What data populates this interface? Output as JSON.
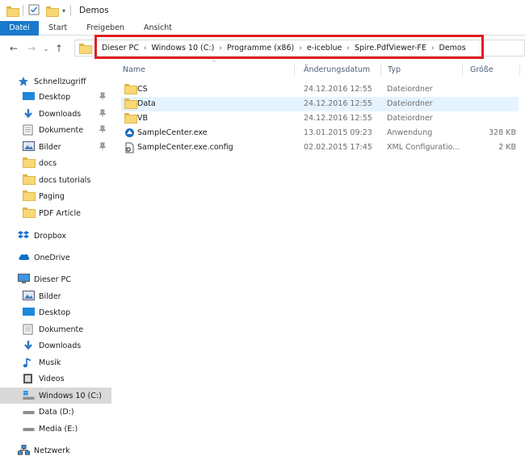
{
  "window": {
    "title": "Demos"
  },
  "ribbon": {
    "tabs": [
      "Datei",
      "Start",
      "Freigeben",
      "Ansicht"
    ]
  },
  "address": {
    "crumbs": [
      "Dieser PC",
      "Windows 10 (C:)",
      "Programme (x86)",
      "e-iceblue",
      "Spire.PdfViewer-FE",
      "Demos"
    ],
    "highlight_color": "#e21c23"
  },
  "nav": {
    "items": [
      {
        "label": "Schnellzugriff",
        "icon": "star-icon"
      },
      {
        "label": "Desktop",
        "icon": "desktop-icon"
      },
      {
        "label": "Downloads",
        "icon": "download-icon"
      },
      {
        "label": "Dokumente",
        "icon": "documents-icon"
      },
      {
        "label": "Bilder",
        "icon": "pictures-icon"
      },
      {
        "label": "docs",
        "icon": "folder-icon"
      },
      {
        "label": "docs tutorials",
        "icon": "folder-icon"
      },
      {
        "label": "Paging",
        "icon": "folder-icon"
      },
      {
        "label": "PDF Article",
        "icon": "folder-icon"
      },
      {
        "label": "Dropbox",
        "icon": "dropbox-icon"
      },
      {
        "label": "OneDrive",
        "icon": "cloud-icon"
      },
      {
        "label": "Dieser PC",
        "icon": "computer-icon"
      },
      {
        "label": "Bilder",
        "icon": "pictures-icon"
      },
      {
        "label": "Desktop",
        "icon": "desktop-icon"
      },
      {
        "label": "Dokumente",
        "icon": "documents-icon"
      },
      {
        "label": "Downloads",
        "icon": "download-icon"
      },
      {
        "label": "Musik",
        "icon": "music-icon"
      },
      {
        "label": "Videos",
        "icon": "video-icon"
      },
      {
        "label": "Windows 10 (C:)",
        "icon": "windows-drive-icon"
      },
      {
        "label": "Data (D:)",
        "icon": "drive-icon"
      },
      {
        "label": "Media (E:)",
        "icon": "drive-icon"
      },
      {
        "label": "Netzwerk",
        "icon": "network-icon"
      }
    ]
  },
  "list": {
    "columns": [
      "Name",
      "Änderungsdatum",
      "Typ",
      "Größe"
    ],
    "rows": [
      {
        "name": "CS",
        "date": "24.12.2016 12:55",
        "type": "Dateiordner",
        "size": "",
        "icon": "folder-icon"
      },
      {
        "name": "Data",
        "date": "24.12.2016 12:55",
        "type": "Dateiordner",
        "size": "",
        "icon": "folder-icon"
      },
      {
        "name": "VB",
        "date": "24.12.2016 12:55",
        "type": "Dateiordner",
        "size": "",
        "icon": "folder-icon"
      },
      {
        "name": "SampleCenter.exe",
        "date": "13.01.2015 09:23",
        "type": "Anwendung",
        "size": "328 KB",
        "icon": "app-icon"
      },
      {
        "name": "SampleCenter.exe.config",
        "date": "02.02.2015 17:45",
        "type": "XML Configuratio...",
        "size": "2 KB",
        "icon": "config-file-icon"
      }
    ]
  }
}
